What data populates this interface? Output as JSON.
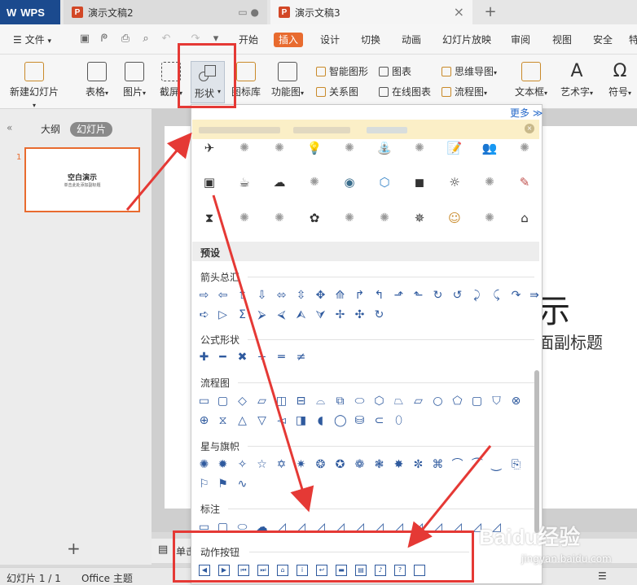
{
  "titlebar": {
    "app_name": "WPS",
    "tabs": [
      {
        "label": "演示文稿2"
      },
      {
        "label": "演示文稿3"
      }
    ],
    "close_glyph": "×",
    "new_tab_glyph": "+"
  },
  "menubar": {
    "file_label": "文件",
    "items": [
      "开始",
      "插入",
      "设计",
      "切换",
      "动画",
      "幻灯片放映",
      "审阅",
      "视图",
      "安全"
    ],
    "cut_item": "特"
  },
  "ribbon": {
    "new_slide": "新建幻灯片",
    "table": "表格",
    "picture": "图片",
    "screenshot": "截屏",
    "shape": "形状",
    "icon_lib": "图标库",
    "func_chart": "功能图",
    "smart_shape": "智能图形",
    "chart": "图表",
    "relation": "关系图",
    "online_chart": "在线图表",
    "mindmap": "思维导图",
    "flowchart": "流程图",
    "textbox": "文本框",
    "wordart": "艺术字",
    "symbol": "符号"
  },
  "leftpanel": {
    "tab_outline": "大纲",
    "tab_slides": "幻灯片",
    "slide_number": "1",
    "thumb_title": "空白演示",
    "thumb_sub": "单击此处添加副标题",
    "add_glyph": "+"
  },
  "slide": {
    "title_partial": "示",
    "subtitle_partial": "面副标题"
  },
  "notes": {
    "label_partial": "单击"
  },
  "statusbar": {
    "slide_count": "幻灯片 1 / 1",
    "theme": "Office 主题"
  },
  "dropdown": {
    "more": "更多 ≫",
    "preset_header": "预设",
    "sections": {
      "arrows": "箭头总汇",
      "formula": "公式形状",
      "flowchart": "流程图",
      "stars": "星与旗帜",
      "callouts": "标注",
      "action_buttons": "动作按钮"
    }
  },
  "watermark": {
    "main": "Baidu经验",
    "sub": "jingyan.baidu.com"
  },
  "colors": {
    "accent": "#e86b2f",
    "annotation": "#e53935",
    "shape_blue": "#2f5a9e",
    "wps_blue": "#1b4a8e"
  }
}
